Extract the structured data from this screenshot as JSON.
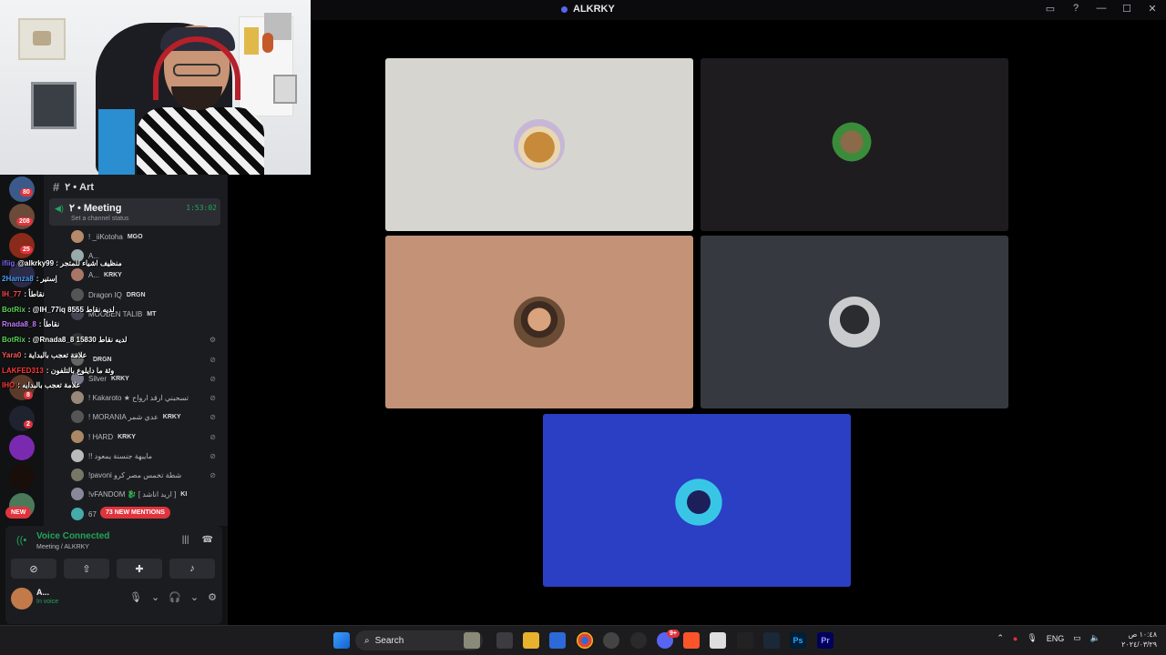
{
  "window": {
    "title": "ALKRKY",
    "controls": [
      "screen-share-icon",
      "help-icon",
      "minimize-icon",
      "maximize-icon",
      "close-icon"
    ]
  },
  "call": {
    "tiles": [
      {
        "name": "tile-1",
        "bg": "#d6d5cf",
        "avatar": "fox-avatar"
      },
      {
        "name": "tile-2",
        "bg": "#1e1c1f",
        "avatar": "bear-avatar"
      },
      {
        "name": "tile-3",
        "bg": "#c39277",
        "avatar": "man-avatar"
      },
      {
        "name": "tile-4",
        "bg": "#363a40",
        "avatar": "shadow-avatar"
      },
      {
        "name": "tile-5",
        "bg": "#2a3fc4",
        "avatar": "anime-avatar"
      }
    ]
  },
  "sidebar": {
    "channel_header": "٢ • Art",
    "voice_channel": {
      "name": "٢ • Meeting",
      "status": "Set a channel status",
      "time": "1:53:02"
    },
    "members": [
      {
        "name": "! _iiKotoha",
        "tag": "MGO"
      },
      {
        "name": "A...",
        "tag": ""
      },
      {
        "name": "A...",
        "tag": "KRKY"
      },
      {
        "name": "Dragon IQ",
        "tag": "DRGN"
      },
      {
        "name": "MOOBEN TALIB",
        "tag": "MT"
      },
      {
        "name": "",
        "tag": ""
      },
      {
        "name": "",
        "tag": "DRGN"
      },
      {
        "name": "Silver",
        "tag": "KRKY"
      },
      {
        "name": "! Kakaroto ★ تسحبني ارقد ارواح",
        "tag": ""
      },
      {
        "name": "! MORANIA عدي شمر",
        "tag": "KRKY"
      },
      {
        "name": "! HARD",
        "tag": "KRKY"
      },
      {
        "name": "!! مايبهة جنسنة يمعود",
        "tag": ""
      },
      {
        "name": "!pavoni شطة تخمس مصر كرو",
        "tag": ""
      },
      {
        "name": "!vFANDOM 🐉 [ اريد اناشد ]",
        "tag": "KI"
      },
      {
        "name": "67",
        "tag": ""
      }
    ],
    "server_badges": [
      "80",
      "208",
      "25",
      "8",
      "2"
    ],
    "new_label": "NEW",
    "mentions_label": "73 NEW MENTIONS"
  },
  "chat_overlay": [
    {
      "user": "ifiig",
      "text": "@alkrky99 : منظيف اشياء للمتجر",
      "color": "#7b6cff"
    },
    {
      "user": "2Hamza8",
      "text": ": اِستير",
      "color": "#4ea3ff"
    },
    {
      "user": "IH_77",
      "text": ": نقاطأ",
      "color": "#ff4a4a"
    },
    {
      "user": "BotRix",
      "text": ": @IH_77iq لديه نقاط 8555",
      "color": "#5cd65c"
    },
    {
      "user": "Rnada8_8",
      "text": ": نقاطأ",
      "color": "#c77dff"
    },
    {
      "user": "BotRix",
      "text": ": @Rnada8_8 لديه نقاط 15830",
      "color": "#5cd65c"
    },
    {
      "user": "Yara0",
      "text": ": علامة تعجب بالبداية",
      "color": "#ff5a5a"
    },
    {
      "user": "LAKFED313",
      "text": ": وئة ما دايلوع بالتلفون",
      "color": "#ff3b3b"
    },
    {
      "user": "IHO",
      "text": ": علامة تعجب بالبدايه",
      "color": "#ff3b3b"
    }
  ],
  "voice_panel": {
    "status": "Voice Connected",
    "location": "Meeting / ALKRKY",
    "user_name": "A...",
    "user_status": "In voice"
  },
  "taskbar": {
    "search_label": "Search",
    "lang": "ENG",
    "time": "١٠:٤٨ ص",
    "date": "٢٠٢٤/٠٣/٢٩",
    "discord_badge": "9+"
  }
}
